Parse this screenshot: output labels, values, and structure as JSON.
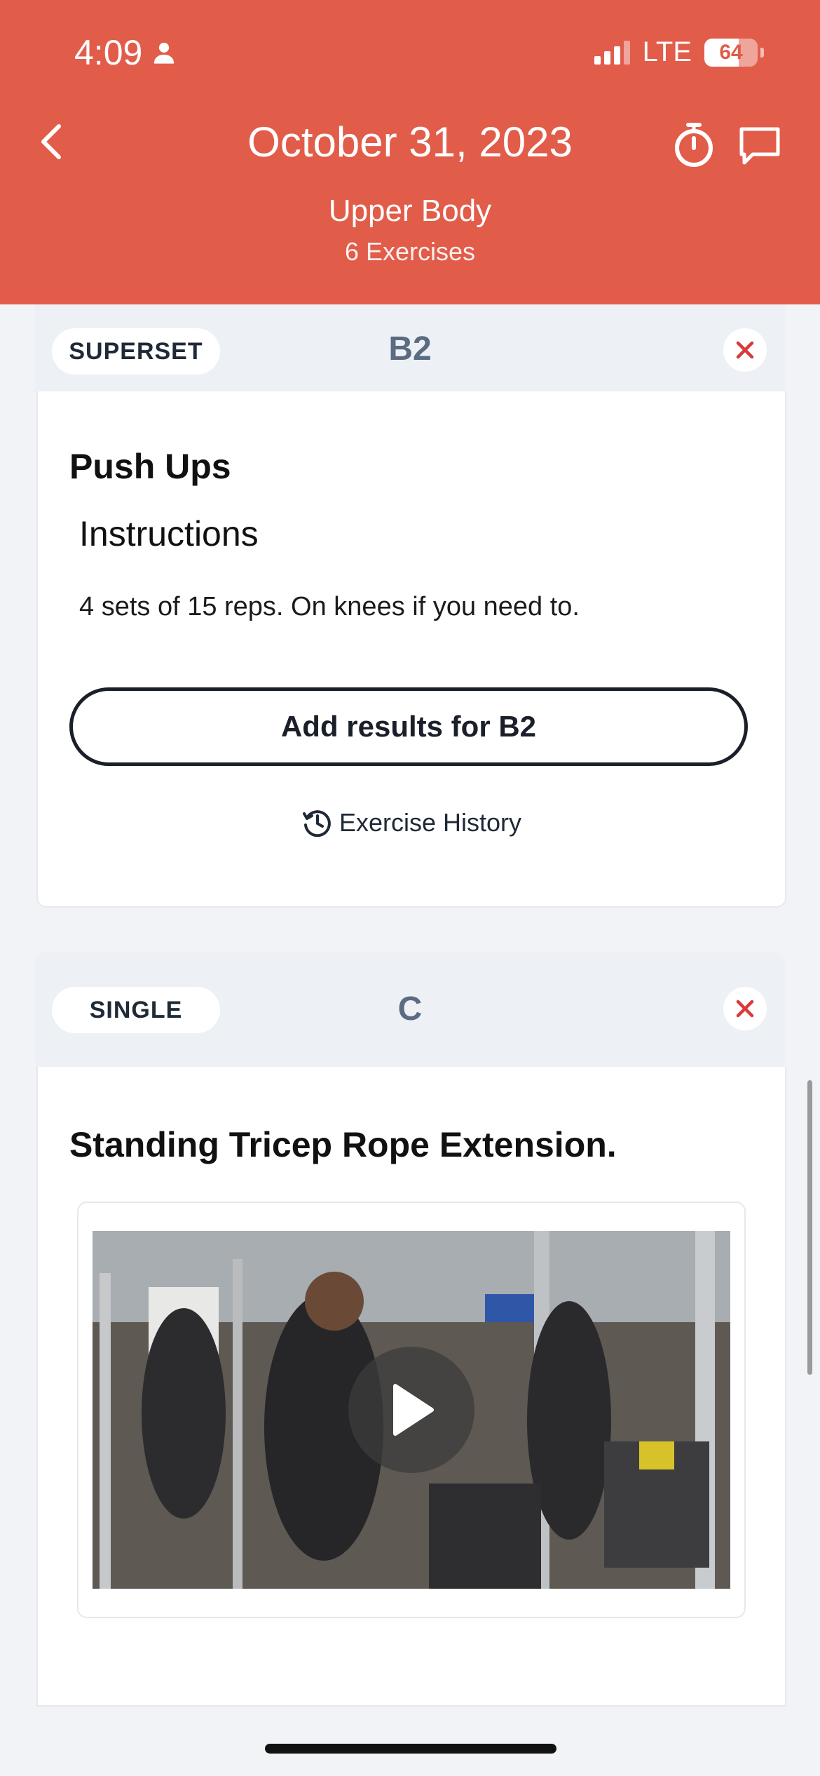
{
  "status_bar": {
    "time": "4:09",
    "network": "LTE",
    "battery": "64",
    "battery_level": 0.64
  },
  "header": {
    "title": "October 31, 2023",
    "workout_name": "Upper Body",
    "exercise_count": "6 Exercises"
  },
  "blocks": [
    {
      "type_label": "SUPERSET",
      "block_label": "B2",
      "exercise_name": "Push Ups",
      "instructions_heading": "Instructions",
      "instructions_text": "4 sets of 15 reps. On knees if you need to.",
      "add_results_label": "Add results for B2",
      "history_label": "Exercise History"
    },
    {
      "type_label": "SINGLE",
      "block_label": "C",
      "exercise_name": "Standing Tricep Rope Extension."
    }
  ],
  "colors": {
    "header_bg": "#e25c4a",
    "remove_x": "#d93a3a",
    "block_label": "#5a6b82"
  },
  "icons": [
    "back-chevron-icon",
    "stopwatch-icon",
    "chat-icon",
    "close-x-icon",
    "history-clock-icon",
    "play-icon",
    "person-icon"
  ]
}
